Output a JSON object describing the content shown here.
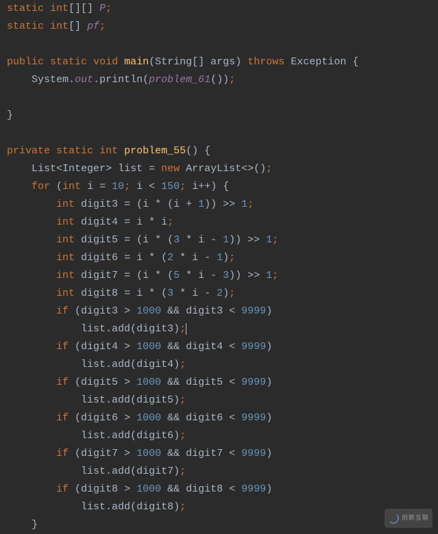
{
  "lines": {
    "l1_static": "static",
    "l1_int": "int",
    "l1_brackets": "[][]",
    "l1_P": "P",
    "l2_static": "static",
    "l2_int": "int",
    "l2_brackets": "[]",
    "l2_pf": "pf",
    "l4_public": "public",
    "l4_static": "static",
    "l4_void": "void",
    "l4_main": "main",
    "l4_String": "String",
    "l4_brackets": "[]",
    "l4_args": "args",
    "l4_throws": "throws",
    "l4_Exception": "Exception",
    "l5_System": "System",
    "l5_out": "out",
    "l5_println": "println",
    "l5_problem": "problem_61",
    "l9_private": "private",
    "l9_static": "static",
    "l9_int": "int",
    "l9_problem": "problem_55",
    "l10_List": "List",
    "l10_Integer": "Integer",
    "l10_list": "list",
    "l10_new": "new",
    "l10_ArrayList": "ArrayList",
    "l11_for": "for",
    "l11_int": "int",
    "l11_i": "i",
    "l11_10": "10",
    "l11_150": "150",
    "l12_int": "int",
    "l12_digit3": "digit3",
    "l12_1a": "1",
    "l12_1b": "1",
    "l13_int": "int",
    "l13_digit4": "digit4",
    "l14_int": "int",
    "l14_digit5": "digit5",
    "l14_3": "3",
    "l14_1a": "1",
    "l14_1b": "1",
    "l15_int": "int",
    "l15_digit6": "digit6",
    "l15_2": "2",
    "l15_1": "1",
    "l16_int": "int",
    "l16_digit7": "digit7",
    "l16_5": "5",
    "l16_3": "3",
    "l16_1": "1",
    "l17_int": "int",
    "l17_digit8": "digit8",
    "l17_3": "3",
    "l17_2": "2",
    "if_digit3_a": "digit3",
    "if_digit3_b": "digit3",
    "if_digit4_a": "digit4",
    "if_digit4_b": "digit4",
    "if_digit5_a": "digit5",
    "if_digit5_b": "digit5",
    "if_digit6_a": "digit6",
    "if_digit6_b": "digit6",
    "if_digit7_a": "digit7",
    "if_digit7_b": "digit7",
    "if_digit8_a": "digit8",
    "if_digit8_b": "digit8",
    "add_digit3": "digit3",
    "add_digit4": "digit4",
    "add_digit5": "digit5",
    "add_digit6": "digit6",
    "add_digit7": "digit7",
    "add_digit8": "digit8",
    "if": "if",
    "n1000": "1000",
    "n9999": "9999",
    "and": "&&",
    "listadd": "list.add",
    "watermark": "创新互联"
  }
}
